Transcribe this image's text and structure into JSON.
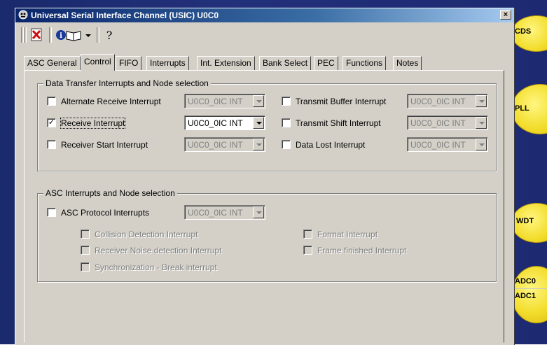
{
  "window": {
    "title": "Universal Serial Interface Channel (USIC) U0C0",
    "close_label": "×"
  },
  "tabs": [
    {
      "label": "ASC General"
    },
    {
      "label": "Control"
    },
    {
      "label": "FIFO"
    },
    {
      "label": "Interrupts"
    },
    {
      "label": "Int. Extension"
    },
    {
      "label": "Bank Select"
    },
    {
      "label": "PEC"
    },
    {
      "label": "Functions"
    },
    {
      "label": "Notes"
    }
  ],
  "data_transfer": {
    "title": "Data Transfer Interrupts and Node selection",
    "left": [
      {
        "label": "Alternate Receive Interrupt",
        "checked": false,
        "enabled": false,
        "node": "U0C0_0IC INT"
      },
      {
        "label": "Receive Interrupt",
        "checked": true,
        "enabled": true,
        "node": "U0C0_0IC INT"
      },
      {
        "label": "Receiver Start Interrupt",
        "checked": false,
        "enabled": false,
        "node": "U0C0_0IC INT"
      }
    ],
    "right": [
      {
        "label": "Transmit Buffer Interrupt",
        "checked": false,
        "node": "U0C0_0IC INT"
      },
      {
        "label": "Transmit Shift Interrupt",
        "checked": false,
        "node": "U0C0_0IC INT"
      },
      {
        "label": "Data Lost Interrupt",
        "checked": false,
        "node": "U0C0_0IC INT"
      }
    ]
  },
  "asc_interrupts": {
    "title": "ASC Interrupts and Node selection",
    "protocol_label": "ASC Protocol Interrupts",
    "protocol_node": "U0C0_0IC INT",
    "sub_left": [
      {
        "label": "Collision Detection Interrupt"
      },
      {
        "label": "Receiver Noise detection Interrupt"
      },
      {
        "label": "Synchronization - Break interrupt"
      }
    ],
    "sub_right": [
      {
        "label": "Format Interrupt"
      },
      {
        "label": "Frame finished Interrupt"
      }
    ]
  },
  "background": {
    "bubbles": [
      "CDS",
      "PLL",
      "WDT",
      "ADC0",
      "ADC1"
    ]
  },
  "colors": {
    "title_start": "#0a246a",
    "title_end": "#a6caf0",
    "dialog_face": "#d4d0c8",
    "bubble": "#f2dc2a"
  },
  "icons": [
    "window-app-icon",
    "delete-icon",
    "info-book-icon",
    "help-icon"
  ]
}
